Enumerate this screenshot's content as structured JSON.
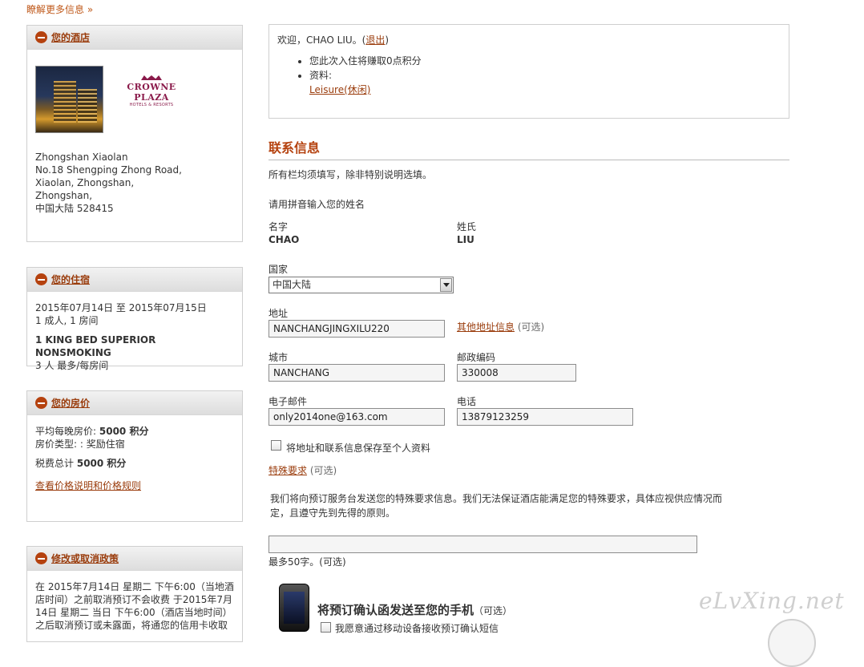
{
  "top_link": "瞭解更多信息 »",
  "sidebar": {
    "hotel": {
      "title": "您的酒店",
      "logo_name": "CROWNE PLAZA",
      "logo_sub": "HOTELS & RESORTS",
      "address": [
        "Zhongshan Xiaolan",
        "No.18 Shengping Zhong Road,",
        "Xiaolan, Zhongshan,",
        "Zhongshan,",
        "中国大陆   528415"
      ]
    },
    "stay": {
      "title": "您的住宿",
      "dates": "2015年07月14日  至  2015年07月15日",
      "guests": "1 成人, 1 房间",
      "room": "1 KING BED SUPERIOR NONSMOKING",
      "max": "3 人 最多/每房间"
    },
    "rate": {
      "title": "您的房价",
      "avg_label": "平均每晚房价:",
      "avg_value": "5000  积分",
      "type_label": "房价类型: : 奖励住宿",
      "tax_label": "税费总计",
      "tax_value": "5000  积分",
      "rules_link": "查看价格说明和价格规则"
    },
    "cancel": {
      "title": "修改或取消政策",
      "text": [
        "在 2015年7月14日 星期二 下午6:00（当地酒",
        "店时间）之前取消预订不会收费 于2015年7月",
        "14日 星期二 当日 下午6:00（酒店当地时间）",
        "之后取消预订或未露面，将通您的信用卡收取"
      ]
    }
  },
  "welcome": {
    "greeting_prefix": "欢迎，CHAO LIU。(",
    "logout": "退出",
    "greeting_suffix": ")",
    "points": "您此次入住将赚取0点积分",
    "profile_label": "资料:",
    "profile_link": "Leisure(休闲)"
  },
  "contact": {
    "title": "联系信息",
    "required_note": "所有栏均须填写，除非特别说明选填。",
    "pinyin_note": "请用拼音输入您的姓名",
    "first_name_label": "名字",
    "first_name": "CHAO",
    "last_name_label": "姓氏",
    "last_name": "LIU",
    "country_label": "国家",
    "country_value": "中国大陆",
    "address_label": "地址",
    "address_value": "NANCHANGJINGXILU220",
    "other_address_link": "其他地址信息",
    "optional": "(可选)",
    "city_label": "城市",
    "city_value": "NANCHANG",
    "postal_label": "邮政编码",
    "postal_value": "330008",
    "email_label": "电子邮件",
    "email_value": "only2014one@163.com",
    "phone_label": "电话",
    "phone_value": "13879123259",
    "save_label": "将地址和联系信息保存至个人资料",
    "special_link": "特殊要求",
    "special_note_1": "我们将向预订服务台发送您的特殊要求信息。我们无法保证酒店能满足您的特殊要求，具体应视供应情况而",
    "special_note_2": "定，且遵守先到先得的原则。",
    "max_chars": "最多50字。(可选)",
    "mobile_title": "将预订确认函发送至您的手机",
    "mobile_optional": "（可选）",
    "mobile_check": "我愿意通过移动设备接收预订确认短信"
  },
  "watermark": "eLvXing.net"
}
